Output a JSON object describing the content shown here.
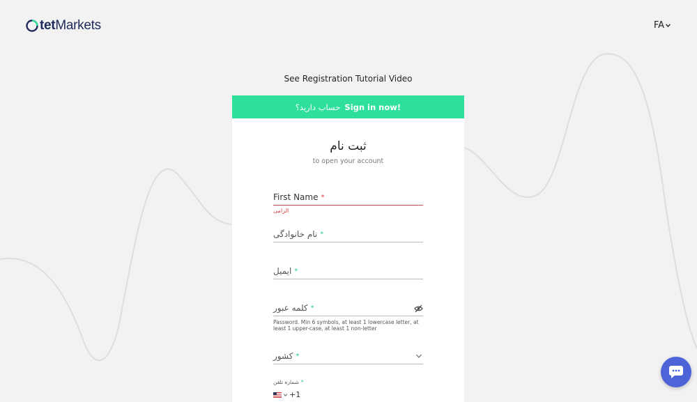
{
  "brand": {
    "logo_suffix_bold": "tet",
    "logo_suffix": "Markets"
  },
  "header": {
    "language": "FA"
  },
  "tutorial_link": "See Registration Tutorial Video",
  "signin_bar": {
    "question": "حساب دارید؟",
    "link": "Sign in now!"
  },
  "form": {
    "title": "ثبت نام",
    "subtitle": "to open your account",
    "first_name": {
      "label": "First Name",
      "required": "*",
      "error": "الزامی"
    },
    "last_name": {
      "label": "نام خانوادگی",
      "required": "*"
    },
    "email": {
      "label": "ایمیل",
      "required": "*"
    },
    "password": {
      "label": "کلمه عبور",
      "required": "*",
      "hint": "Password. Min 6 symbols, at least 1 lowercase letter, at least 1 upper-case, at least 1 non-letter"
    },
    "country": {
      "label": "کشور",
      "required": "*"
    },
    "phone": {
      "label": "شماره تلفن",
      "required": "*",
      "dial_code": "+1"
    }
  },
  "colors": {
    "accent_green": "#2ee09b",
    "chat_blue": "#4d63d8",
    "error_red": "#d83c3c",
    "brand_navy": "#1f2a5a"
  }
}
